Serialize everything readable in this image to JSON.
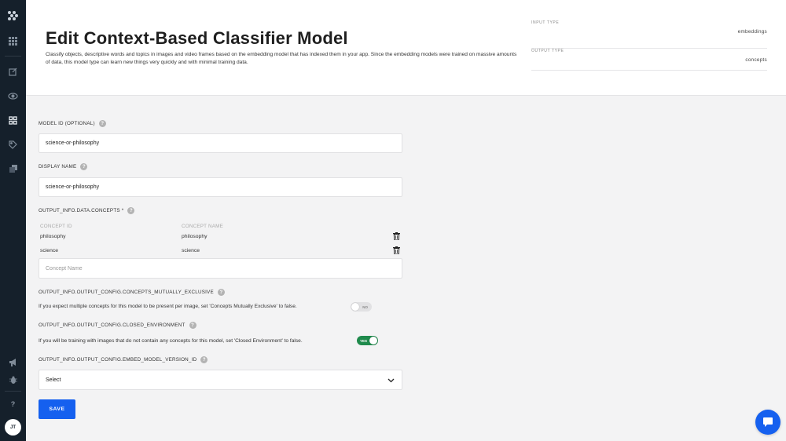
{
  "header": {
    "title": "Edit Context-Based Classifier Model",
    "description": "Classify objects, descriptive words and topics in images and video frames based on the embedding model that has indexed them in your app. Since the embedding models were trained on massive amounts of data, this model type can learn new things very quickly and with minimal training data.",
    "input_type_label": "INPUT TYPE",
    "input_type_value": "embeddings",
    "output_type_label": "OUTPUT TYPE",
    "output_type_value": "concepts"
  },
  "sidebar": {
    "icons": [
      "logo-icon",
      "apps-grid-icon",
      "edit-icon",
      "eye-icon",
      "dashboard-icon",
      "tag-icon",
      "copy-icon",
      "megaphone-icon",
      "bug-icon",
      "help-icon"
    ],
    "help_label": "?",
    "avatar_initials": "JT"
  },
  "form": {
    "model_id_label": "MODEL ID (OPTIONAL)",
    "model_id_value": "science-or-philosophy",
    "display_name_label": "DISPLAY NAME",
    "display_name_value": "science-or-philosophy",
    "concepts_label": "OUTPUT_INFO.DATA.CONCEPTS *",
    "concepts_columns": [
      "CONCEPT ID",
      "CONCEPT NAME"
    ],
    "concepts": [
      {
        "id": "philosophy",
        "name": "philosophy"
      },
      {
        "id": "science",
        "name": "science"
      }
    ],
    "concept_name_placeholder": "Concept Name",
    "mutually_exclusive_label": "OUTPUT_INFO.OUTPUT_CONFIG.CONCEPTS_MUTUALLY_EXCLUSIVE",
    "mutually_exclusive_hint": "If you expect multiple concepts for this model to be present per image, set 'Concepts Mutually Exclusive' to false.",
    "mutually_exclusive_toggle": "NO",
    "closed_env_label": "OUTPUT_INFO.OUTPUT_CONFIG.CLOSED_ENVIRONMENT",
    "closed_env_hint": "If you will be training with images that do not contain any concepts for this model, set 'Closed Environment' to false.",
    "closed_env_toggle": "YES",
    "embed_model_label": "OUTPUT_INFO.OUTPUT_CONFIG.EMBED_MODEL_VERSION_ID",
    "embed_model_value": "Select",
    "save_label": "SAVE",
    "help_glyph": "?"
  },
  "colors": {
    "sidebar_bg": "#15202b",
    "primary": "#1560ef",
    "toggle_on": "#1f8a4c"
  }
}
